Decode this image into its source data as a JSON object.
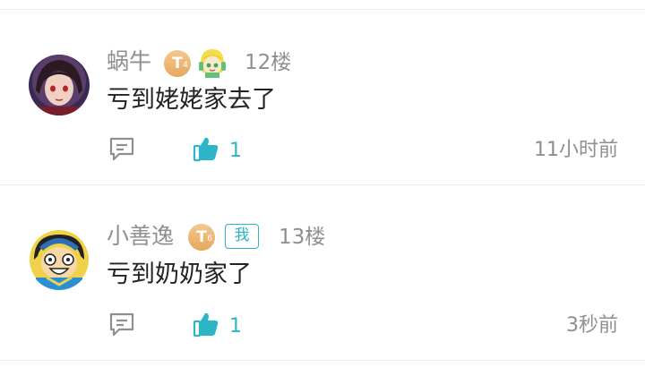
{
  "comments": [
    {
      "username": "蜗牛",
      "level_letter": "T",
      "level_num": "4",
      "floor": "12楼",
      "content": "亏到姥姥家去了",
      "likes": "1",
      "time": "11小时前",
      "has_pendant_icon": true,
      "is_me": false
    },
    {
      "username": "小善逸",
      "level_letter": "T",
      "level_num": "6",
      "me_badge": "我",
      "floor": "13楼",
      "content": "亏到奶奶家了",
      "likes": "1",
      "time": "3秒前",
      "has_pendant_icon": false,
      "is_me": true
    }
  ],
  "colors": {
    "accent": "#2bb5c6",
    "text_primary": "#222222",
    "text_secondary": "#8f8f8f",
    "level_badge": "#e6a75d",
    "divider": "#ececec"
  },
  "icons": [
    "comment-icon",
    "thumbs-up-icon"
  ]
}
